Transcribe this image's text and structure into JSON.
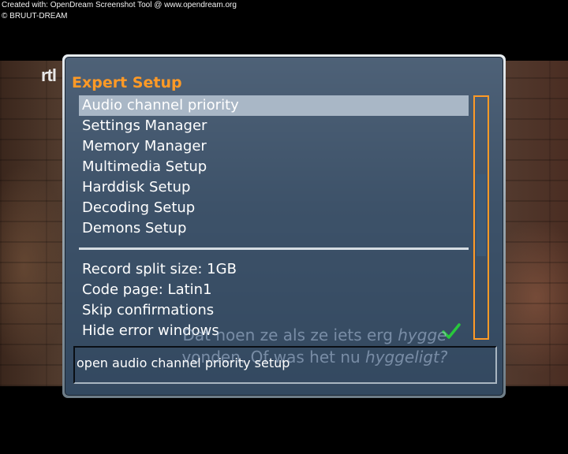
{
  "credit": {
    "line1": "Created with: OpenDream Screenshot Tool @ www.opendream.org",
    "line2": "© BRUUT-DREAM"
  },
  "channel_logo": "rtl",
  "window": {
    "title": "Expert Setup",
    "menu": [
      {
        "label": "Audio channel priority",
        "selected": true
      },
      {
        "label": "Settings Manager"
      },
      {
        "label": "Memory Manager"
      },
      {
        "label": "Multimedia Setup"
      },
      {
        "label": "Harddisk Setup"
      },
      {
        "label": "Decoding Setup"
      },
      {
        "label": "Demons Setup"
      }
    ],
    "options": [
      {
        "label": "Record split size: 1GB"
      },
      {
        "label": "Code page: Latin1"
      },
      {
        "label": "Skip confirmations"
      },
      {
        "label": "Hide error windows",
        "checked": true
      }
    ],
    "scrollbar": {
      "thumb_start_fraction": 0.32,
      "thumb_end_fraction": 0.66
    },
    "hint": "open audio channel priority setup"
  },
  "subtitle": {
    "line1_a": "Dat noen ze als ze iets erg ",
    "line1_b": "hygge",
    "line2_a": "vonden. Of was het nu ",
    "line2_b": "hyggeligt?"
  },
  "colors": {
    "accent": "#ff9a26",
    "selection": "#a9b7c6",
    "check": "#28c83c",
    "panel": "#223a54"
  }
}
